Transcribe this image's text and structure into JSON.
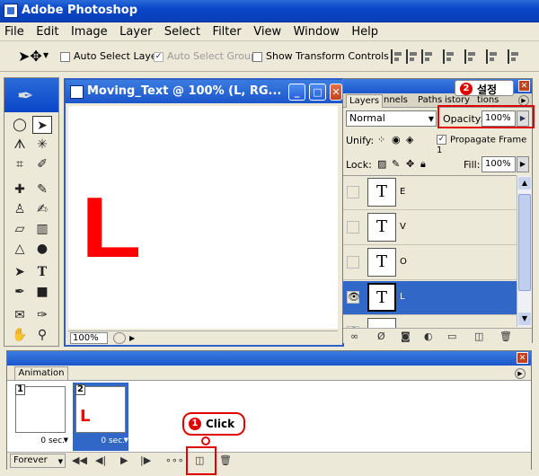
{
  "app": {
    "title": "Adobe Photoshop"
  },
  "menu": [
    "File",
    "Edit",
    "Image",
    "Layer",
    "Select",
    "Filter",
    "View",
    "Window",
    "Help"
  ],
  "options": {
    "auto_select_layer": "Auto Select Layer",
    "auto_select_groups": "Auto Select Groups",
    "show_transform_controls": "Show Transform Controls"
  },
  "document": {
    "title": "Moving_Text @ 100% (L, RG...",
    "letter": "L",
    "zoom": "100%"
  },
  "layers_panel": {
    "tabs": [
      "Layers",
      "nnels",
      "Paths",
      "istory",
      "tions"
    ],
    "blend_mode": "Normal",
    "opacity_label": "Opacity:",
    "opacity_value": "100%",
    "unify_label": "Unify:",
    "propagate_label": "Propagate Frame 1",
    "lock_label": "Lock:",
    "fill_label": "Fill:",
    "fill_value": "100%",
    "layers": [
      {
        "name": "E",
        "thumb": "T"
      },
      {
        "name": "V",
        "thumb": "T"
      },
      {
        "name": "O",
        "thumb": "T"
      },
      {
        "name": "L",
        "thumb": "T"
      }
    ]
  },
  "animation_panel": {
    "tab": "Animation",
    "frames": [
      {
        "num": "1",
        "delay": "0 sec."
      },
      {
        "num": "2",
        "delay": "0 sec.",
        "letter": "L"
      }
    ],
    "loop": "Forever"
  },
  "annotations": {
    "step1_num": "1",
    "step1_text": "Click",
    "step2_num": "2",
    "step2_text": "설정"
  },
  "colors": {
    "accent_red": "#e00000",
    "title_blue": "#0a46c8",
    "selected_blue": "#3168c8"
  }
}
